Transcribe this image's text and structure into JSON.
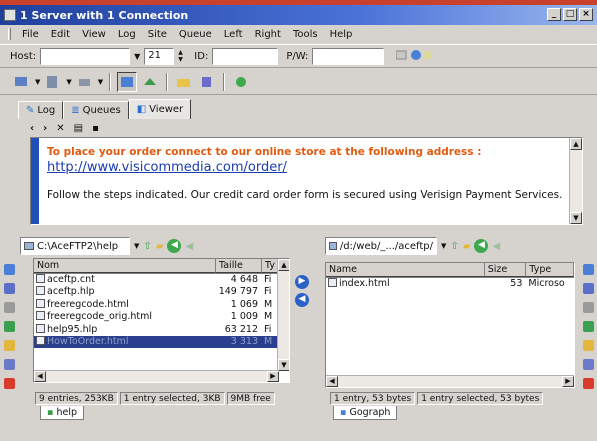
{
  "window": {
    "title": "1 Server with 1 Connection",
    "buttons": [
      "_",
      "□",
      "×"
    ]
  },
  "menu": [
    "File",
    "Edit",
    "View",
    "Log",
    "Site",
    "Queue",
    "Left",
    "Right",
    "Tools",
    "Help"
  ],
  "connection": {
    "host_label": "Host:",
    "host_value": "",
    "port_value": "21",
    "id_label": "ID:",
    "id_value": "",
    "pw_label": "P/W:",
    "pw_value": ""
  },
  "tabs": [
    "Log",
    "Queues",
    "Viewer"
  ],
  "viewer": {
    "line1": "To place your order connect to our online store at the following address :",
    "link": "http://www.visicommedia.com/order/",
    "body": "Follow the steps indicated. Our credit card order form is secured using Verisign Payment Services."
  },
  "left": {
    "path": "C:\\AceFTP2\\help",
    "columns": [
      "Nom",
      "Taille",
      "Ty"
    ],
    "files": [
      {
        "name": "aceftp.cnt",
        "size": "4 648",
        "type": "Fi"
      },
      {
        "name": "aceftp.hlp",
        "size": "149 797",
        "type": "Fi"
      },
      {
        "name": "freeregcode.html",
        "size": "1 069",
        "type": "M"
      },
      {
        "name": "freeregcode_orig.html",
        "size": "1 009",
        "type": "M"
      },
      {
        "name": "help95.hlp",
        "size": "63 212",
        "type": "Fi"
      },
      {
        "name": "HowToOrder.html",
        "size": "3 313",
        "type": "M"
      }
    ],
    "status": [
      "9 entries, 253KB",
      "1 entry selected, 3KB",
      "9MB free"
    ],
    "bottom_tab": "help"
  },
  "right": {
    "path": "/d:/web/_.../aceftp/",
    "columns": [
      "Name",
      "Size",
      "Type"
    ],
    "files": [
      {
        "name": "index.html",
        "size": "53",
        "type": "Microso"
      }
    ],
    "status": [
      "1 entry, 53 bytes",
      "1 entry selected, 53 bytes"
    ],
    "bottom_tab": "Gograph"
  },
  "colors": {
    "title_gradient_start": "#1f3f9c",
    "viewer_orange": "#e25b11",
    "link_blue": "#1a3cb0",
    "selection": "#2a3f8e"
  }
}
